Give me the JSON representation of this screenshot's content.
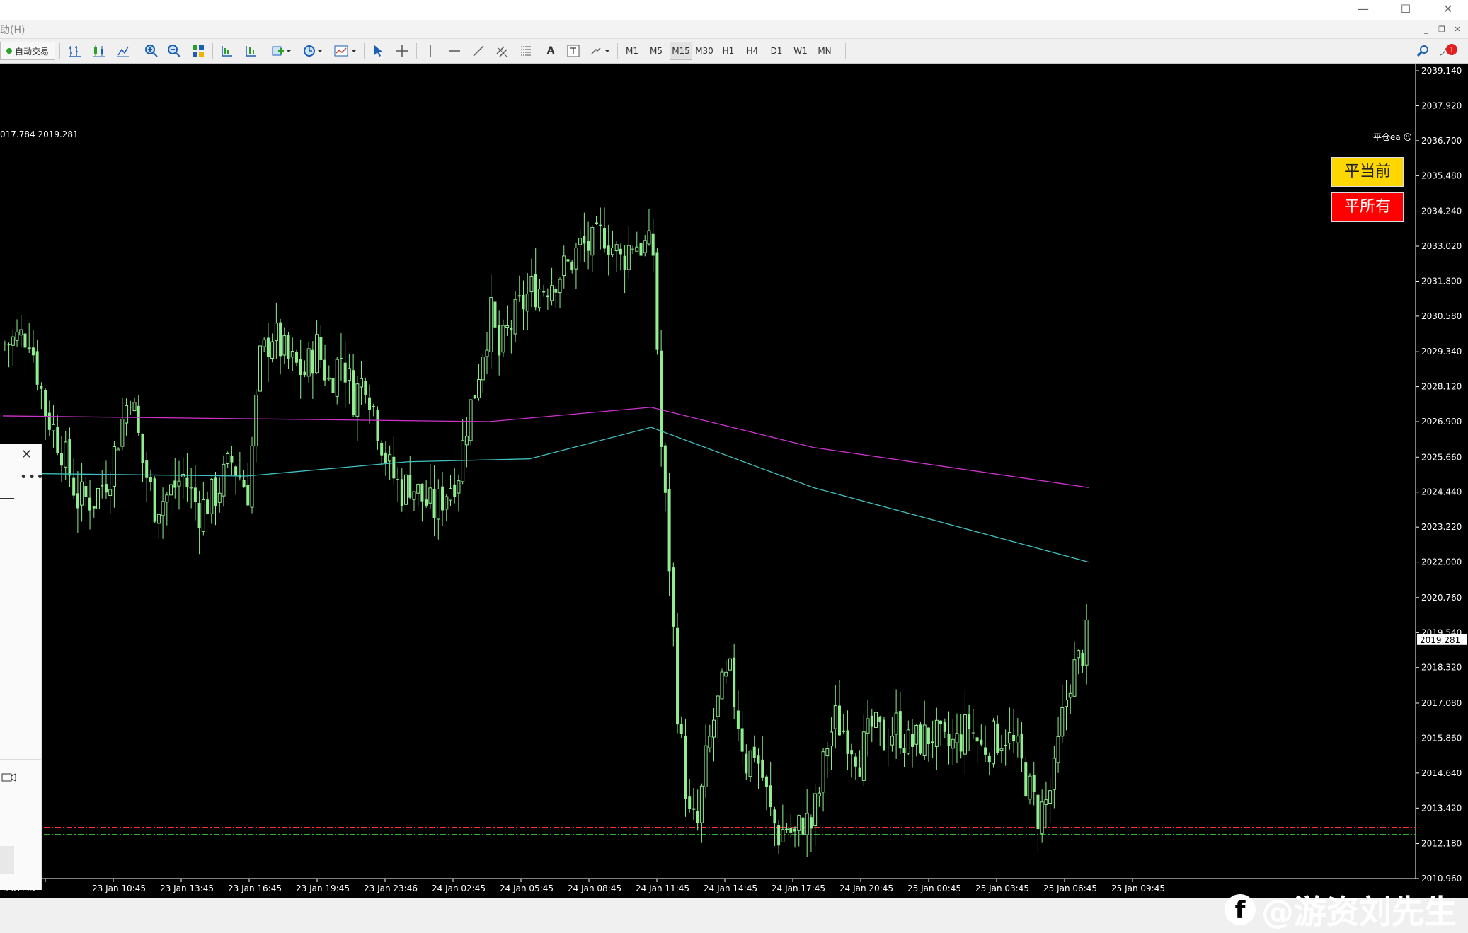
{
  "window": {
    "menu_help": "助(H)",
    "controls": {
      "minimize": "—",
      "maximize": "☐",
      "close": "✕"
    },
    "mdi_controls": {
      "minimize": "_",
      "restore": "❐",
      "close": "✕"
    }
  },
  "toolbar": {
    "autotrade_label": "自动交易",
    "timeframes": [
      "M1",
      "M5",
      "M15",
      "M30",
      "H1",
      "H4",
      "D1",
      "W1",
      "MN"
    ],
    "active_timeframe": "M15",
    "text_tool": "A",
    "notification_count": "1"
  },
  "chart": {
    "price_readout": "017.784 2019.281",
    "ea_label": "平仓ea ☺",
    "buttons": {
      "close_current": "平当前",
      "close_all": "平所有"
    },
    "watermark": "@游资刘先生"
  },
  "colors": {
    "candle": "#90ee90",
    "ma_slow": "#cc33cc",
    "ma_fast": "#40c0c0",
    "level_red": "#ff3333",
    "level_green": "#33cc33",
    "btn_yellow": "#ffd700",
    "btn_red": "#ff0000"
  },
  "chart_data": {
    "type": "candlestick",
    "symbol_timeframe": "M15",
    "current_price": "2019.281",
    "y_ticks": [
      "2039.140",
      "2037.920",
      "2036.700",
      "2035.480",
      "2034.240",
      "2033.020",
      "2031.800",
      "2030.580",
      "2029.340",
      "2028.120",
      "2026.900",
      "2025.660",
      "2024.440",
      "2023.220",
      "2022.000",
      "2020.760",
      "2019.540",
      "2018.320",
      "2017.080",
      "2015.860",
      "2014.640",
      "2013.420",
      "2012.180",
      "2010.960"
    ],
    "ylim": [
      2010.96,
      2039.14
    ],
    "x_ticks": [
      "n 07:45",
      "23 Jan 10:45",
      "23 Jan 13:45",
      "23 Jan 16:45",
      "23 Jan 19:45",
      "23 Jan 23:46",
      "24 Jan 02:45",
      "24 Jan 05:45",
      "24 Jan 08:45",
      "24 Jan 11:45",
      "24 Jan 14:45",
      "24 Jan 17:45",
      "24 Jan 20:45",
      "25 Jan 00:45",
      "25 Jan 03:45",
      "25 Jan 06:45",
      "25 Jan 09:45"
    ],
    "close_path": [
      [
        0,
        2029.6
      ],
      [
        6,
        2030.0
      ],
      [
        10,
        2027.3
      ],
      [
        14,
        2026.0
      ],
      [
        18,
        2024.2
      ],
      [
        22,
        2024.2
      ],
      [
        26,
        2025.2
      ],
      [
        28,
        2026.4
      ],
      [
        31,
        2028.0
      ],
      [
        34,
        2025.5
      ],
      [
        37,
        2024.0
      ],
      [
        40,
        2024.3
      ],
      [
        44,
        2025.0
      ],
      [
        48,
        2023.8
      ],
      [
        52,
        2024.4
      ],
      [
        56,
        2025.5
      ],
      [
        60,
        2024.5
      ],
      [
        63,
        2029.0
      ],
      [
        66,
        2030.0
      ],
      [
        70,
        2029.0
      ],
      [
        74,
        2028.6
      ],
      [
        77,
        2029.5
      ],
      [
        80,
        2028.3
      ],
      [
        83,
        2029.2
      ],
      [
        86,
        2027.8
      ],
      [
        89,
        2028.5
      ],
      [
        92,
        2026.8
      ],
      [
        95,
        2025.2
      ],
      [
        98,
        2024.5
      ],
      [
        100,
        2024.8
      ],
      [
        103,
        2024.2
      ],
      [
        106,
        2023.8
      ],
      [
        109,
        2024.5
      ],
      [
        112,
        2025.2
      ],
      [
        114,
        2026.9
      ],
      [
        116,
        2028.0
      ],
      [
        118,
        2029.5
      ],
      [
        120,
        2030.6
      ],
      [
        122,
        2029.2
      ],
      [
        124,
        2030.0
      ],
      [
        127,
        2030.8
      ],
      [
        130,
        2031.5
      ],
      [
        133,
        2031.6
      ],
      [
        136,
        2032.0
      ],
      [
        139,
        2032.3
      ],
      [
        142,
        2033.0
      ],
      [
        145,
        2033.0
      ],
      [
        148,
        2033.5
      ],
      [
        152,
        2032.5
      ],
      [
        155,
        2033.2
      ],
      [
        158,
        2033.0
      ],
      [
        160,
        2032.8
      ],
      [
        161,
        2029.5
      ],
      [
        162,
        2026.0
      ],
      [
        163,
        2024.0
      ],
      [
        164,
        2022.0
      ],
      [
        165,
        2019.5
      ],
      [
        166,
        2017.0
      ],
      [
        167,
        2015.5
      ],
      [
        169,
        2013.0
      ],
      [
        171,
        2012.8
      ],
      [
        173,
        2015.0
      ],
      [
        175,
        2016.5
      ],
      [
        177,
        2017.5
      ],
      [
        179,
        2018.0
      ],
      [
        181,
        2016.5
      ],
      [
        183,
        2015.0
      ],
      [
        185,
        2015.5
      ],
      [
        187,
        2014.5
      ],
      [
        189,
        2013.2
      ],
      [
        191,
        2012.5
      ],
      [
        193,
        2012.8
      ],
      [
        195,
        2012.4
      ],
      [
        197,
        2013.0
      ],
      [
        199,
        2012.8
      ],
      [
        201,
        2014.0
      ],
      [
        203,
        2015.7
      ],
      [
        205,
        2016.5
      ],
      [
        208,
        2016.0
      ],
      [
        211,
        2015.2
      ],
      [
        214,
        2016.2
      ],
      [
        217,
        2015.8
      ],
      [
        220,
        2016.3
      ],
      [
        223,
        2015.6
      ],
      [
        226,
        2015.8
      ],
      [
        229,
        2016.0
      ],
      [
        232,
        2015.5
      ],
      [
        235,
        2015.7
      ],
      [
        238,
        2016.3
      ],
      [
        241,
        2015.5
      ],
      [
        244,
        2015.8
      ],
      [
        247,
        2016.0
      ],
      [
        250,
        2015.3
      ],
      [
        253,
        2014.0
      ],
      [
        255,
        2013.2
      ],
      [
        257,
        2013.6
      ],
      [
        259,
        2014.5
      ],
      [
        261,
        2016.5
      ],
      [
        263,
        2018.0
      ],
      [
        265,
        2018.5
      ],
      [
        267,
        2019.3
      ]
    ],
    "bar_count": 268,
    "moving_averages": [
      {
        "color": "#cc33cc",
        "points": [
          [
            0,
            2027.1
          ],
          [
            60,
            2027.0
          ],
          [
            120,
            2026.9
          ],
          [
            160,
            2027.4
          ],
          [
            200,
            2026.0
          ],
          [
            268,
            2024.6
          ]
        ]
      },
      {
        "color": "#40c0c0",
        "points": [
          [
            0,
            2025.1
          ],
          [
            60,
            2025.0
          ],
          [
            100,
            2025.5
          ],
          [
            130,
            2025.6
          ],
          [
            160,
            2026.7
          ],
          [
            200,
            2024.6
          ],
          [
            268,
            2022.0
          ]
        ]
      }
    ],
    "horizontal_levels": [
      {
        "price": 2012.75,
        "color": "#ff3333",
        "style": "dashdot"
      },
      {
        "price": 2012.5,
        "color": "#33cc33",
        "style": "dashdot"
      }
    ]
  }
}
